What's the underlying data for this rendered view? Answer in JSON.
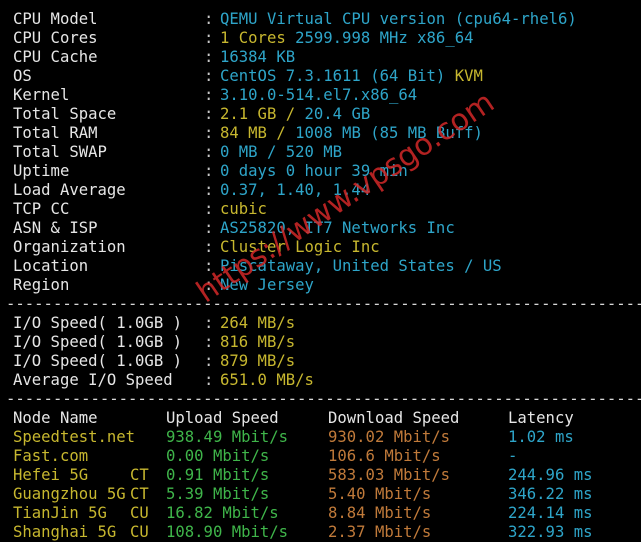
{
  "sysinfo": [
    {
      "label": "CPU Model",
      "parts": [
        {
          "text": "QEMU Virtual CPU version (cpu64-rhel6)",
          "color": "cyan"
        }
      ]
    },
    {
      "label": "CPU Cores",
      "parts": [
        {
          "text": "1 Cores ",
          "color": "yellow"
        },
        {
          "text": "2599.998 MHz x86_64",
          "color": "cyan"
        }
      ]
    },
    {
      "label": "CPU Cache",
      "parts": [
        {
          "text": "16384 KB",
          "color": "cyan"
        }
      ]
    },
    {
      "label": "OS",
      "parts": [
        {
          "text": "CentOS 7.3.1611 (64 Bit) ",
          "color": "cyan"
        },
        {
          "text": "KVM",
          "color": "yellow"
        }
      ]
    },
    {
      "label": "Kernel",
      "parts": [
        {
          "text": "3.10.0-514.el7.x86_64",
          "color": "cyan"
        }
      ]
    },
    {
      "label": "Total Space",
      "parts": [
        {
          "text": "2.1 GB / ",
          "color": "yellow"
        },
        {
          "text": "20.4 GB",
          "color": "cyan"
        }
      ]
    },
    {
      "label": "Total RAM",
      "parts": [
        {
          "text": "84 MB / ",
          "color": "yellow"
        },
        {
          "text": "1008 MB ",
          "color": "cyan"
        },
        {
          "text": "(85 MB Buff)",
          "color": "cyan"
        }
      ]
    },
    {
      "label": "Total SWAP",
      "parts": [
        {
          "text": "0 MB / ",
          "color": "cyan"
        },
        {
          "text": "520 MB",
          "color": "cyan"
        }
      ]
    },
    {
      "label": "Uptime",
      "parts": [
        {
          "text": "0 days 0 hour 39 min",
          "color": "cyan"
        }
      ]
    },
    {
      "label": "Load Average",
      "parts": [
        {
          "text": "0.37, 1.40, 1.44",
          "color": "cyan"
        }
      ]
    },
    {
      "label": "TCP CC",
      "parts": [
        {
          "text": "cubic",
          "color": "yellow"
        }
      ]
    },
    {
      "label": "ASN & ISP",
      "parts": [
        {
          "text": "AS25820, IT7 Networks Inc",
          "color": "cyan"
        }
      ]
    },
    {
      "label": "Organization",
      "parts": [
        {
          "text": "Cluster Logic Inc",
          "color": "yellow"
        }
      ]
    },
    {
      "label": "Location",
      "parts": [
        {
          "text": "Piscataway, United States / US",
          "color": "cyan"
        }
      ]
    },
    {
      "label": "Region",
      "parts": [
        {
          "text": "New Jersey",
          "color": "cyan"
        }
      ]
    }
  ],
  "separator": "----------------------------------------------------------------------",
  "io": [
    {
      "label": "I/O Speed( 1.0GB )",
      "value": "264 MB/s"
    },
    {
      "label": "I/O Speed( 1.0GB )",
      "value": "816 MB/s"
    },
    {
      "label": "I/O Speed( 1.0GB )",
      "value": "879 MB/s"
    },
    {
      "label": "Average I/O Speed",
      "value": "651.0 MB/s"
    }
  ],
  "speed_header": {
    "node": "Node Name",
    "upload": "Upload Speed",
    "download": "Download Speed",
    "latency": "Latency"
  },
  "speed_rows": [
    {
      "node": "Speedtest.net",
      "isp": "",
      "upload": "938.49 Mbit/s",
      "download": "930.02 Mbit/s",
      "latency": "1.02 ms"
    },
    {
      "node": "Fast.com",
      "isp": "",
      "upload": "0.00 Mbit/s",
      "download": "106.6 Mbit/s",
      "latency": "-"
    },
    {
      "node": "Hefei 5G",
      "isp": "CT",
      "upload": "0.91 Mbit/s",
      "download": "583.03 Mbit/s",
      "latency": "244.96 ms"
    },
    {
      "node": "Guangzhou 5G",
      "isp": "CT",
      "upload": "5.39 Mbit/s",
      "download": "5.40 Mbit/s",
      "latency": "346.22 ms"
    },
    {
      "node": "TianJin 5G",
      "isp": "CU",
      "upload": "16.82 Mbit/s",
      "download": "8.84 Mbit/s",
      "latency": "224.14 ms"
    },
    {
      "node": "Shanghai 5G",
      "isp": "CU",
      "upload": "108.90 Mbit/s",
      "download": "2.37 Mbit/s",
      "latency": "322.93 ms"
    }
  ],
  "watermark": "https://www.vpsgo.com",
  "colors": {
    "yellow": "#c7b72f",
    "cyan": "#2ea5c9",
    "green": "#3fb54a",
    "orange": "#c07a3a",
    "white": "#e6e6e6"
  }
}
